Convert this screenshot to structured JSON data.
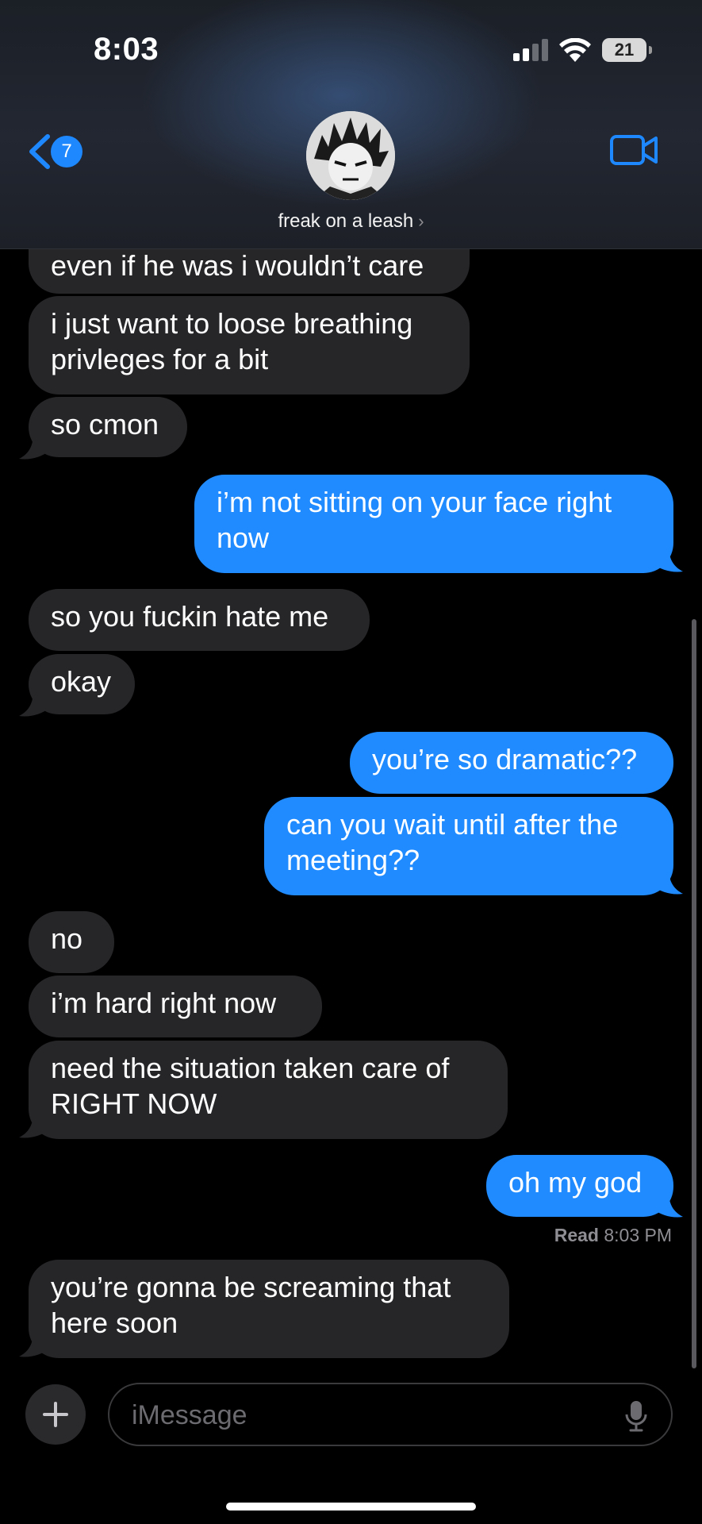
{
  "status_bar": {
    "time": "8:03",
    "battery": "21",
    "icons": [
      "signal-icon",
      "wifi-icon",
      "battery-icon"
    ]
  },
  "header": {
    "back_badge": "7",
    "contact_name": "freak on a leash",
    "icons": [
      "chevron-left-icon",
      "video-camera-icon",
      "chevron-right-icon"
    ]
  },
  "messages": [
    {
      "from": "them",
      "text": "even if he was i wouldn’t care"
    },
    {
      "from": "them",
      "text": "i just want to loose breathing\nprivleges for a bit"
    },
    {
      "from": "them",
      "text": "so cmon"
    },
    {
      "from": "me",
      "text": "i’m not sitting on your face right\nnow"
    },
    {
      "from": "them",
      "text": "so you fuckin hate me"
    },
    {
      "from": "them",
      "text": "okay"
    },
    {
      "from": "me",
      "text": "you’re so dramatic??"
    },
    {
      "from": "me",
      "text": "can you wait until after the\nmeeting??"
    },
    {
      "from": "them",
      "text": "no"
    },
    {
      "from": "them",
      "text": "i’m hard right now"
    },
    {
      "from": "them",
      "text": "need the situation taken care of\nRIGHT NOW"
    },
    {
      "from": "me",
      "text": "oh my god"
    },
    {
      "from": "them",
      "text": "you’re gonna be screaming that\nhere soon"
    }
  ],
  "read_receipt": {
    "label": "Read",
    "time": "8:03 PM"
  },
  "input": {
    "placeholder": "iMessage",
    "icons": [
      "plus-icon",
      "microphone-icon"
    ]
  },
  "colors": {
    "sent_bubble": "#1f8bff",
    "received_bubble": "#262629",
    "accent": "#1e88ff",
    "background": "#000000"
  }
}
